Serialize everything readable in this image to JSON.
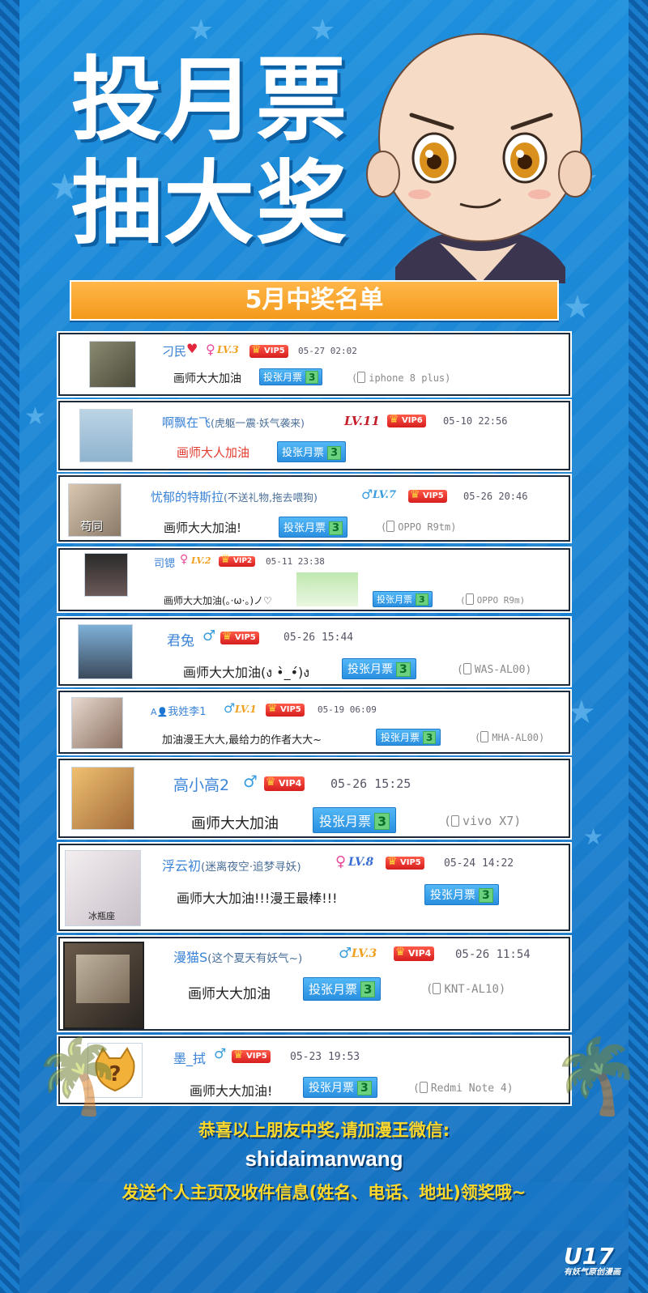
{
  "header": {
    "title_line1": "投月票",
    "title_line2": "抽大奖",
    "banner": "5月中奖名单"
  },
  "entries": [
    {
      "name": "刁民",
      "extra": "",
      "gender": "♀",
      "gender_color": "#e84a9a",
      "level": "LV.3",
      "vip": "VIP5",
      "time": "05-27 02:02",
      "message": "画师大大加油",
      "tickets_label": "投张月票",
      "tickets_count": "3",
      "device": "iphone 8 plus"
    },
    {
      "name": "啊飘在飞",
      "extra": "(虎躯一震·妖气袭来)",
      "gender": "",
      "gender_color": "",
      "level": "LV.11",
      "vip": "VIP6",
      "time": "05-10 22:56",
      "message": "画师大人加油",
      "tickets_label": "投张月票",
      "tickets_count": "3",
      "device": ""
    },
    {
      "name": "忧郁的特斯拉",
      "extra": "(不送礼物,拖去喂狗)",
      "gender": "♂",
      "gender_color": "#3a9de0",
      "level": "LV.7",
      "vip": "VIP5",
      "time": "05-26 20:46",
      "message": "画师大大加油!",
      "tickets_label": "投张月票",
      "tickets_count": "3",
      "device": "OPPO R9tm"
    },
    {
      "name": "司锶",
      "extra": "",
      "gender": "♀",
      "gender_color": "#e84a9a",
      "level": "LV.2",
      "vip": "VIP2",
      "time": "05-11 23:38",
      "message": "画师大大加油(。·ω·。)ノ♡",
      "tickets_label": "投张月票",
      "tickets_count": "3",
      "device": "OPPO R9m"
    },
    {
      "name": "君兔",
      "extra": "",
      "gender": "♂",
      "gender_color": "#3a9de0",
      "level": "",
      "vip": "VIP5",
      "time": "05-26 15:44",
      "message": "画师大大加油(ง •̀_•́)ง",
      "tickets_label": "投张月票",
      "tickets_count": "3",
      "device": "WAS-AL00"
    },
    {
      "name": "我姓李1",
      "extra": "",
      "gender": "♂",
      "gender_color": "#3a9de0",
      "level": "LV.1",
      "vip": "VIP5",
      "time": "05-19 06:09",
      "message": "加油漫王大大,最给力的作者大大~",
      "tickets_label": "投张月票",
      "tickets_count": "3",
      "device": "MHA-AL00"
    },
    {
      "name": "高小高2",
      "extra": "",
      "gender": "♂",
      "gender_color": "#3a9de0",
      "level": "",
      "vip": "VIP4",
      "time": "05-26 15:25",
      "message": "画师大大加油",
      "tickets_label": "投张月票",
      "tickets_count": "3",
      "device": "vivo X7"
    },
    {
      "name": "浮云初",
      "extra": "(迷离夜空·追梦寻妖)",
      "gender": "♀",
      "gender_color": "#e84a9a",
      "level": "LV.8",
      "vip": "VIP5",
      "time": "05-24 14:22",
      "message": "画师大大加油!!!漫王最棒!!!",
      "tickets_label": "投张月票",
      "tickets_count": "3",
      "device": ""
    },
    {
      "name": "漫猫S",
      "extra": "(这个夏天有妖气~)",
      "gender": "♂",
      "gender_color": "#3a9de0",
      "level": "LV.3",
      "vip": "VIP4",
      "time": "05-26 11:54",
      "message": "画师大大加油",
      "tickets_label": "投张月票",
      "tickets_count": "3",
      "device": "KNT-AL10"
    },
    {
      "name": "墨_拭",
      "extra": "",
      "gender": "♂",
      "gender_color": "#3a9de0",
      "level": "",
      "vip": "VIP5",
      "time": "05-23 19:53",
      "message": "画师大大加油!",
      "tickets_label": "投张月票",
      "tickets_count": "3",
      "device": "Redmi Note 4"
    }
  ],
  "avatar_texts": {
    "a3": "苟同",
    "a8": "冰瓶座"
  },
  "footer": {
    "line1": "恭喜以上朋友中奖,请加漫王微信:",
    "wechat": "shidaimanwang",
    "line3": "发送个人主页及收件信息(姓名、电话、地址)领奖哦~"
  },
  "logo": {
    "text": "U17",
    "sub": "有妖气原创漫画"
  },
  "colors": {
    "accent": "#f39a1b",
    "bg": "#1a7fcf",
    "name": "#3a83d6"
  }
}
